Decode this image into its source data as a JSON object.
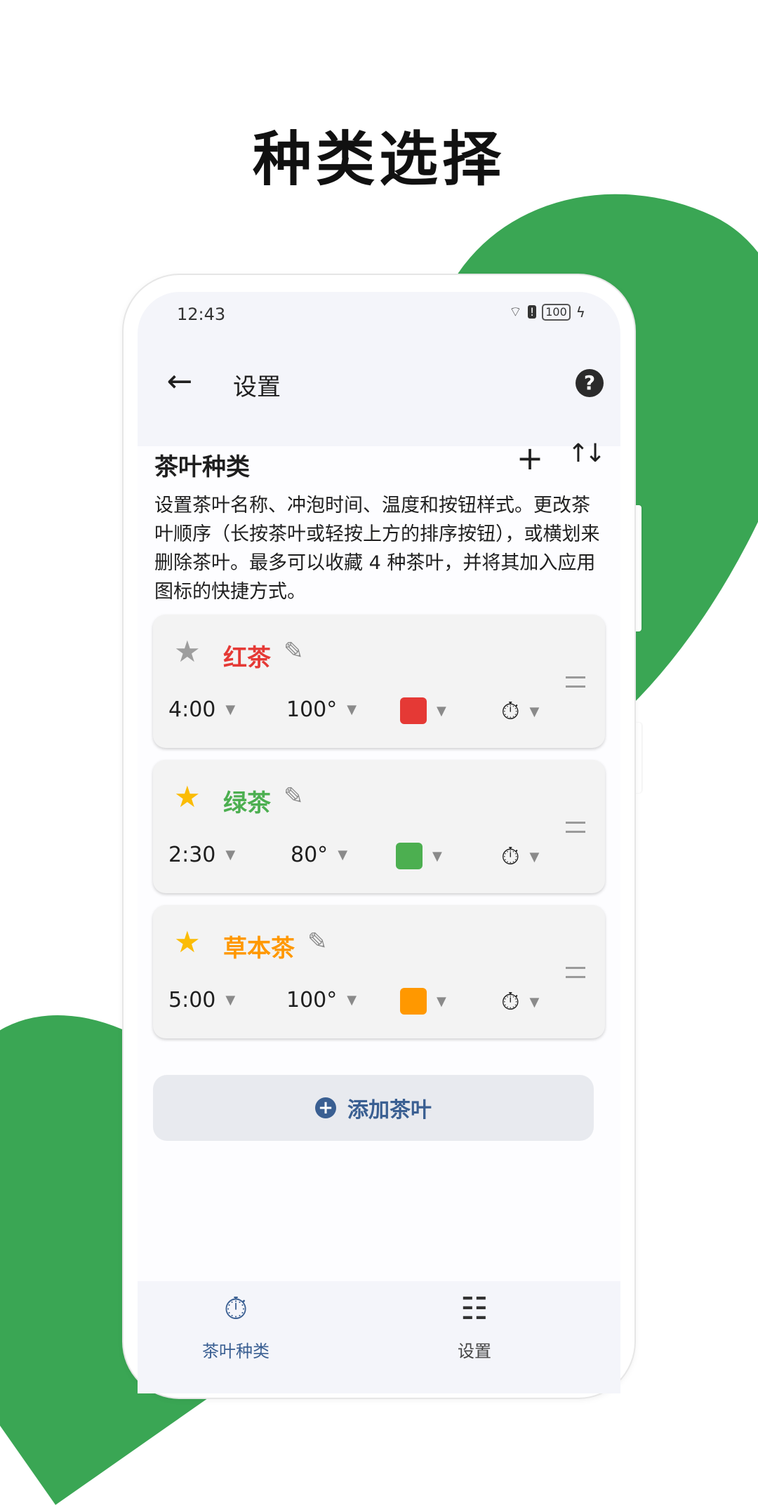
{
  "promo": {
    "title": "种类选择"
  },
  "status_bar": {
    "time": "12:43",
    "battery": "100"
  },
  "appbar": {
    "title": "设置"
  },
  "section": {
    "title": "茶叶种类",
    "description": "设置茶叶名称、冲泡时间、温度和按钮样式。更改茶叶顺序（长按茶叶或轻按上方的排序按钮），或横划来删除茶叶。最多可以收藏 4 种茶叶，并将其加入应用图标的快捷方式。"
  },
  "teas": [
    {
      "name": "红茶",
      "favorite": false,
      "time": "4:00",
      "temp": "100°",
      "color": "#e53935",
      "name_color": "#e53935"
    },
    {
      "name": "绿茶",
      "favorite": true,
      "time": "2:30",
      "temp": "80°",
      "color": "#4caf50",
      "name_color": "#4caf50"
    },
    {
      "name": "草本茶",
      "favorite": true,
      "time": "5:00",
      "temp": "100°",
      "color": "#ff9800",
      "name_color": "#ff9800"
    }
  ],
  "add_button": {
    "label": "添加茶叶"
  },
  "nav": {
    "items": [
      {
        "label": "茶叶种类",
        "icon": "timer-icon",
        "active": true
      },
      {
        "label": "设置",
        "icon": "list-icon",
        "active": false
      }
    ]
  },
  "colors": {
    "accent": "#3a5f92",
    "brand_green": "#3aa654",
    "star_on": "#fbbc05",
    "star_off": "#9e9e9e"
  }
}
